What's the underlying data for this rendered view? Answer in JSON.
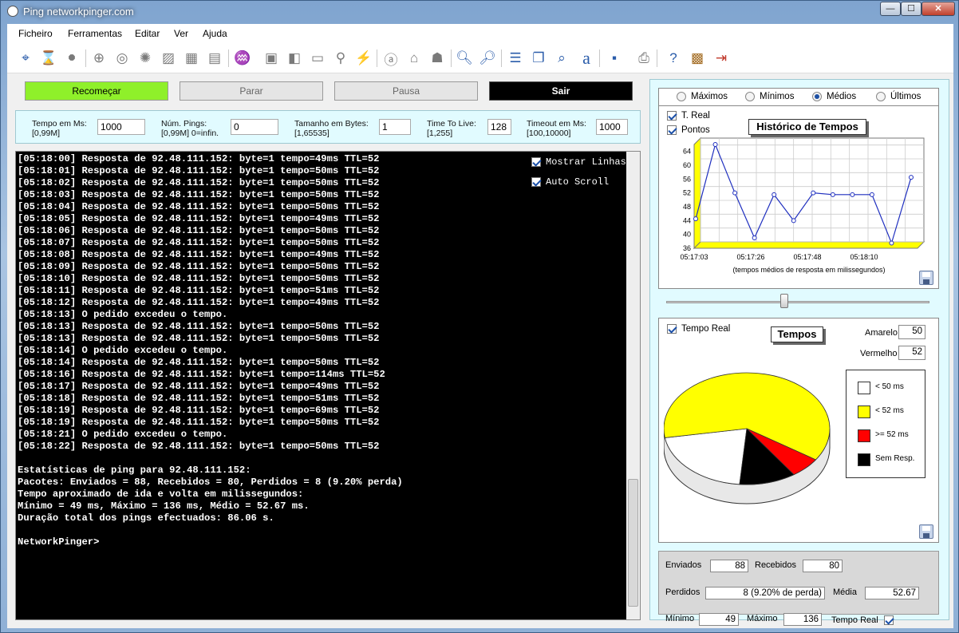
{
  "window": {
    "title": "Ping networkpinger.com",
    "controls": {
      "minimize": "—",
      "maximize": "☐",
      "close": "✕"
    }
  },
  "menu": [
    "Ficheiro",
    "Ferramentas",
    "Editar",
    "Ver",
    "Ajuda"
  ],
  "toolbar_icons": [
    "target-icon",
    "hourglass-icon",
    "stop-icon",
    "crosshair-icon",
    "magnifier-globe-icon",
    "www-icon",
    "monitor-image-icon",
    "grid-icon",
    "wmi-icon",
    "world-icon",
    "network-icon",
    "camera-icon",
    "display-icon",
    "satellite-icon",
    "plug-icon",
    "amazon-icon",
    "bank-icon",
    "handshake-icon",
    "zoom-in-icon",
    "zoom-out-icon",
    "list-icon",
    "copy-icon",
    "find-icon",
    "font-icon",
    "save-icon",
    "print-icon",
    "help-icon",
    "calendar-icon",
    "exit-icon"
  ],
  "buttons": {
    "restart": "Recomeçar",
    "stop": "Parar",
    "pause": "Pausa",
    "exit": "Sair"
  },
  "params": [
    {
      "label1": "Tempo em Ms:",
      "label2": "[0,99M]",
      "value": "1000"
    },
    {
      "label1": "Núm. Pings:",
      "label2": "[0,99M] 0=infin.",
      "value": "0"
    },
    {
      "label1": "Tamanho em Bytes:",
      "label2": "[1,65535]",
      "value": "1"
    },
    {
      "label1": "Time To Live:",
      "label2": "[1,255]",
      "value": "128"
    },
    {
      "label1": "Timeout em Ms:",
      "label2": "[100,10000]",
      "value": "1000"
    }
  ],
  "console": {
    "lines": [
      "[05:18:00] Resposta de 92.48.111.152: byte=1 tempo=49ms TTL=52",
      "[05:18:01] Resposta de 92.48.111.152: byte=1 tempo=50ms TTL=52",
      "[05:18:02] Resposta de 92.48.111.152: byte=1 tempo=50ms TTL=52",
      "[05:18:03] Resposta de 92.48.111.152: byte=1 tempo=50ms TTL=52",
      "[05:18:04] Resposta de 92.48.111.152: byte=1 tempo=50ms TTL=52",
      "[05:18:05] Resposta de 92.48.111.152: byte=1 tempo=49ms TTL=52",
      "[05:18:06] Resposta de 92.48.111.152: byte=1 tempo=50ms TTL=52",
      "[05:18:07] Resposta de 92.48.111.152: byte=1 tempo=50ms TTL=52",
      "[05:18:08] Resposta de 92.48.111.152: byte=1 tempo=49ms TTL=52",
      "[05:18:09] Resposta de 92.48.111.152: byte=1 tempo=50ms TTL=52",
      "[05:18:10] Resposta de 92.48.111.152: byte=1 tempo=50ms TTL=52",
      "[05:18:11] Resposta de 92.48.111.152: byte=1 tempo=51ms TTL=52",
      "[05:18:12] Resposta de 92.48.111.152: byte=1 tempo=49ms TTL=52",
      "[05:18:13] O pedido excedeu o tempo.",
      "[05:18:13] Resposta de 92.48.111.152: byte=1 tempo=50ms TTL=52",
      "[05:18:13] Resposta de 92.48.111.152: byte=1 tempo=50ms TTL=52",
      "[05:18:14] O pedido excedeu o tempo.",
      "[05:18:14] Resposta de 92.48.111.152: byte=1 tempo=50ms TTL=52",
      "[05:18:16] Resposta de 92.48.111.152: byte=1 tempo=114ms TTL=52",
      "[05:18:17] Resposta de 92.48.111.152: byte=1 tempo=49ms TTL=52",
      "[05:18:18] Resposta de 92.48.111.152: byte=1 tempo=51ms TTL=52",
      "[05:18:19] Resposta de 92.48.111.152: byte=1 tempo=69ms TTL=52",
      "[05:18:19] Resposta de 92.48.111.152: byte=1 tempo=50ms TTL=52",
      "[05:18:21] O pedido excedeu o tempo.",
      "[05:18:22] Resposta de 92.48.111.152: byte=1 tempo=50ms TTL=52",
      "",
      "Estatísticas de ping para 92.48.111.152:",
      "Pacotes: Enviados = 88, Recebidos = 80, Perdidos = 8 (9.20% perda)",
      "Tempo aproximado de ida e volta em milissegundos:",
      "Mínimo = 49 ms, Máximo = 136 ms, Médio = 52.67 ms.",
      "Duração total dos pings efectuados: 86.06 s.",
      "",
      "NetworkPinger>"
    ],
    "show_lines_label": "Mostrar Linhas",
    "auto_scroll_label": "Auto Scroll"
  },
  "history": {
    "radios": [
      {
        "label": "Máximos",
        "selected": false
      },
      {
        "label": "Mínimos",
        "selected": false
      },
      {
        "label": "Médios",
        "selected": true
      },
      {
        "label": "Últimos",
        "selected": false
      }
    ],
    "treal_label": "T. Real",
    "points_label": "Pontos",
    "title": "Histórico de Tempos",
    "caption": "(tempos médios de resposta em milissegundos)"
  },
  "tempos": {
    "realtime_label": "Tempo Real",
    "title": "Tempos",
    "amarelo_label": "Amarelo",
    "amarelo_value": "50",
    "vermelho_label": "Vermelho",
    "vermelho_value": "52",
    "legend": [
      "< 50 ms",
      "< 52 ms",
      ">= 52 ms",
      "Sem Resp."
    ]
  },
  "stats": {
    "enviados_label": "Enviados",
    "enviados": "88",
    "recebidos_label": "Recebidos",
    "recebidos": "80",
    "perdidos_label": "Perdidos",
    "perdidos": "8 (9.20% de perda)",
    "media_label": "Média",
    "media": "52.67",
    "minimo_label": "Mínimo",
    "minimo": "49",
    "maximo_label": "Máximo",
    "maximo": "136",
    "tempo_real_label": "Tempo Real"
  },
  "colors": {
    "accent_green": "#8ff02a",
    "yellow": "#ffff00",
    "red": "#ff0000",
    "black": "#000000",
    "white": "#ffffff",
    "line_blue": "#1f2fbf"
  },
  "chart_data": [
    {
      "type": "line",
      "title": "Histórico de Tempos",
      "xlabel": "(tempos médios de resposta em milissegundos)",
      "x_tick_labels": [
        "05:17:03",
        "05:17:26",
        "05:17:48",
        "05:18:10"
      ],
      "ylim": [
        36,
        66
      ],
      "y_ticks": [
        36,
        40,
        44,
        48,
        52,
        56,
        60,
        64
      ],
      "values": [
        44.5,
        66,
        52,
        39,
        51.5,
        44,
        52,
        51.5,
        51.5,
        51.5,
        37.5,
        56.5
      ],
      "grid": true
    },
    {
      "type": "pie",
      "title": "Tempos",
      "labels": [
        "< 50 ms",
        "< 52 ms",
        ">= 52 ms",
        "Sem Resp."
      ],
      "values": [
        21,
        62,
        6,
        11
      ]
    }
  ]
}
